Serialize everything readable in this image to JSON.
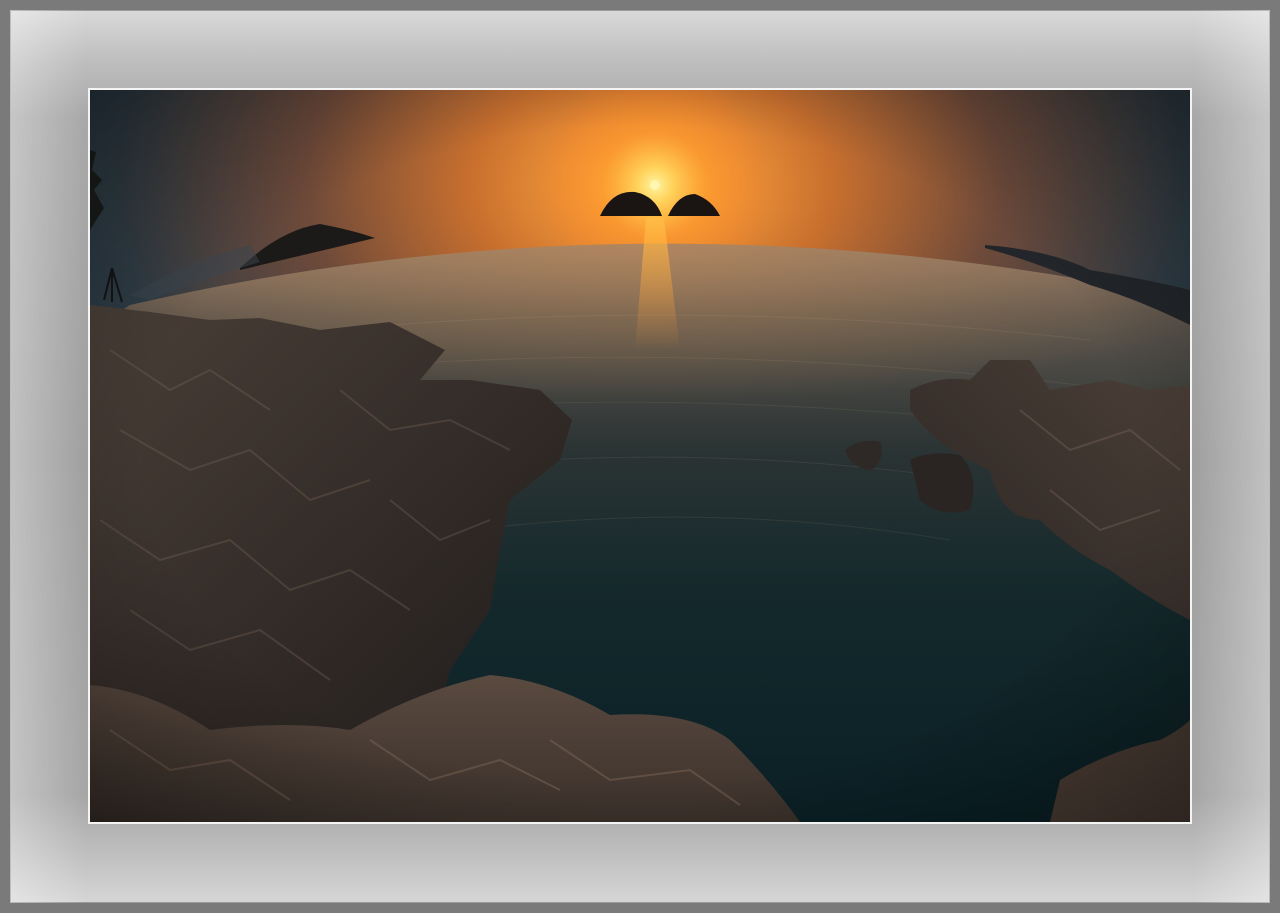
{
  "frame": {
    "mat_color": "#a0a0a0",
    "border_color": "#f4f4f4"
  },
  "photo": {
    "subject": "sunset-over-sea",
    "sky_colors": [
      "#1f3846",
      "#c06a2a",
      "#f39a3a"
    ],
    "sun_color": "#ffd860",
    "water_color": "#0d2a30",
    "rock_color": "#3e3630"
  }
}
